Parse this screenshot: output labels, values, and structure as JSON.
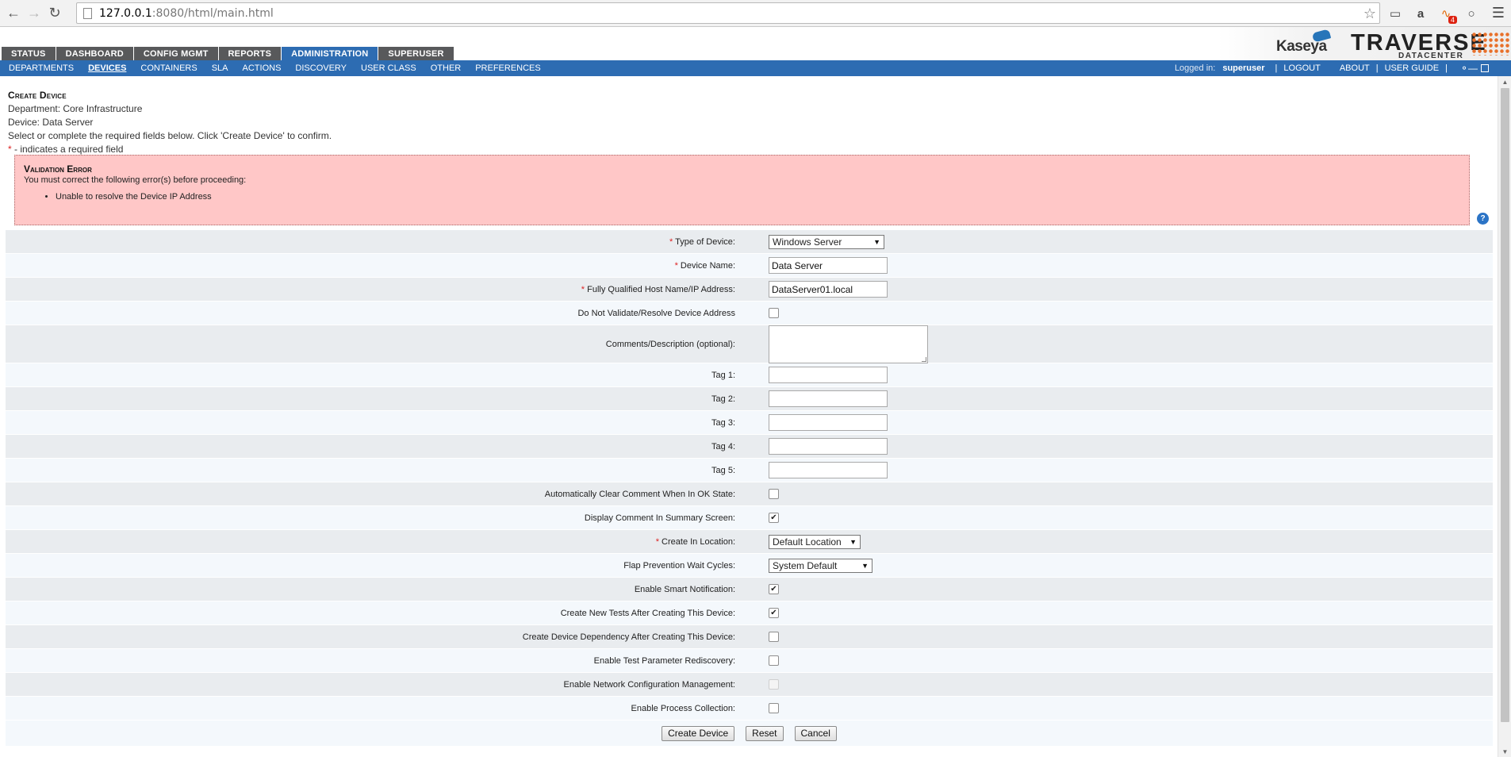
{
  "browser": {
    "url_host": "127.0.0.1",
    "url_path": ":8080/html/main.html",
    "rss_badge": "4"
  },
  "main_tabs": [
    {
      "label": "STATUS",
      "active": false
    },
    {
      "label": "DASHBOARD",
      "active": false
    },
    {
      "label": "CONFIG MGMT",
      "active": false
    },
    {
      "label": "REPORTS",
      "active": false
    },
    {
      "label": "ADMINISTRATION",
      "active": true
    },
    {
      "label": "SUPERUSER",
      "active": false
    }
  ],
  "logo": {
    "kaseya": "Kaseya",
    "traverse": "TRAVERSE",
    "datacenter": "DATACENTER"
  },
  "sub_nav": {
    "items": [
      "DEPARTMENTS",
      "DEVICES",
      "CONTAINERS",
      "SLA",
      "ACTIONS",
      "DISCOVERY",
      "USER CLASS",
      "OTHER",
      "PREFERENCES"
    ],
    "active": "DEVICES",
    "logged_in_label": "Logged in:",
    "user": "superuser",
    "logout": "LOGOUT",
    "about": "ABOUT",
    "user_guide": "USER GUIDE",
    "sep": "|"
  },
  "intro": {
    "title": "Create Device",
    "department": "Department: Core Infrastructure",
    "device": "Device: Data Server",
    "instructions": "Select or complete the required fields below. Click 'Create Device' to confirm.",
    "required_marker": "*",
    "required_note": " - indicates a required field"
  },
  "error": {
    "title": "Validation Error",
    "message": "You must correct the following error(s) before proceeding:",
    "items": [
      "Unable to resolve the Device IP Address"
    ]
  },
  "help_icon": "?",
  "form": {
    "type_of_device": {
      "label": "Type of Device:",
      "value": "Windows Server"
    },
    "device_name": {
      "label": "Device Name:",
      "value": "Data Server"
    },
    "host": {
      "label": "Fully Qualified Host Name/IP Address:",
      "value": "DataServer01.local"
    },
    "no_validate": {
      "label": "Do Not Validate/Resolve Device Address",
      "checked": false
    },
    "comments": {
      "label": "Comments/Description (optional):",
      "value": ""
    },
    "tag1": {
      "label": "Tag 1:",
      "value": ""
    },
    "tag2": {
      "label": "Tag 2:",
      "value": ""
    },
    "tag3": {
      "label": "Tag 3:",
      "value": ""
    },
    "tag4": {
      "label": "Tag 4:",
      "value": ""
    },
    "tag5": {
      "label": "Tag 5:",
      "value": ""
    },
    "auto_clear": {
      "label": "Automatically Clear Comment When In OK State:",
      "checked": false
    },
    "display_comment": {
      "label": "Display Comment In Summary Screen:",
      "checked": true
    },
    "location": {
      "label": "Create In Location:",
      "value": "Default Location"
    },
    "flap": {
      "label": "Flap Prevention Wait Cycles:",
      "value": "System Default"
    },
    "smart_notification": {
      "label": "Enable Smart Notification:",
      "checked": true
    },
    "create_tests": {
      "label": "Create New Tests After Creating This Device:",
      "checked": true
    },
    "create_dependency": {
      "label": "Create Device Dependency After Creating This Device:",
      "checked": false
    },
    "test_rediscovery": {
      "label": "Enable Test Parameter Rediscovery:",
      "checked": false
    },
    "ncm": {
      "label": "Enable Network Configuration Management:",
      "checked": false,
      "disabled": true
    },
    "process_collection": {
      "label": "Enable Process Collection:",
      "checked": false
    }
  },
  "buttons": {
    "create": "Create Device",
    "reset": "Reset",
    "cancel": "Cancel"
  },
  "colors": {
    "accent": "#2d6cb2",
    "tab_gray": "#58595b",
    "error_bg": "#ffc7c7",
    "required": "#dd2222"
  }
}
